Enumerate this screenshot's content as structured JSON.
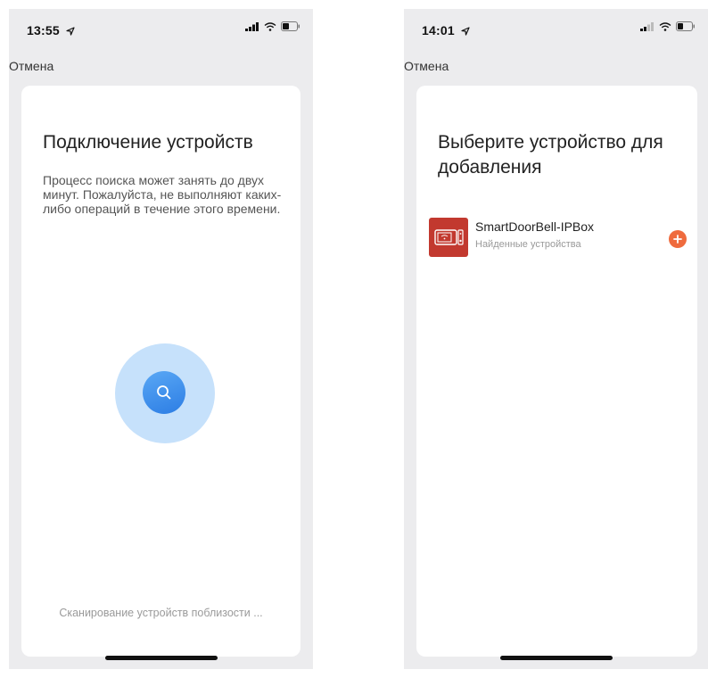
{
  "left_screen": {
    "status": {
      "time": "13:55"
    },
    "nav": {
      "cancel_label": "Отмена"
    },
    "title": "Подключение устройств",
    "description": "Процесс поиска может занять до двух минут. Пожалуйста, не выполняют каких-либо операций в течение этого времени.",
    "scan_status": "Сканирование устройств поблизости ...",
    "search_icon": "search-icon"
  },
  "right_screen": {
    "status": {
      "time": "14:01"
    },
    "nav": {
      "cancel_label": "Отмена"
    },
    "title": "Выберите устройство для добавления",
    "devices": [
      {
        "name": "SmartDoorBell-IPBox",
        "subtitle": "Найденные устройства",
        "icon": "doorbell-device-icon",
        "action_icon": "add-icon"
      }
    ]
  },
  "colors": {
    "background": "#ececee",
    "card": "#ffffff",
    "search_accent": "#2c7de4",
    "search_glow": "#c6e1fb",
    "device_thumb": "#c2392f",
    "add_button": "#ef6b3e"
  }
}
